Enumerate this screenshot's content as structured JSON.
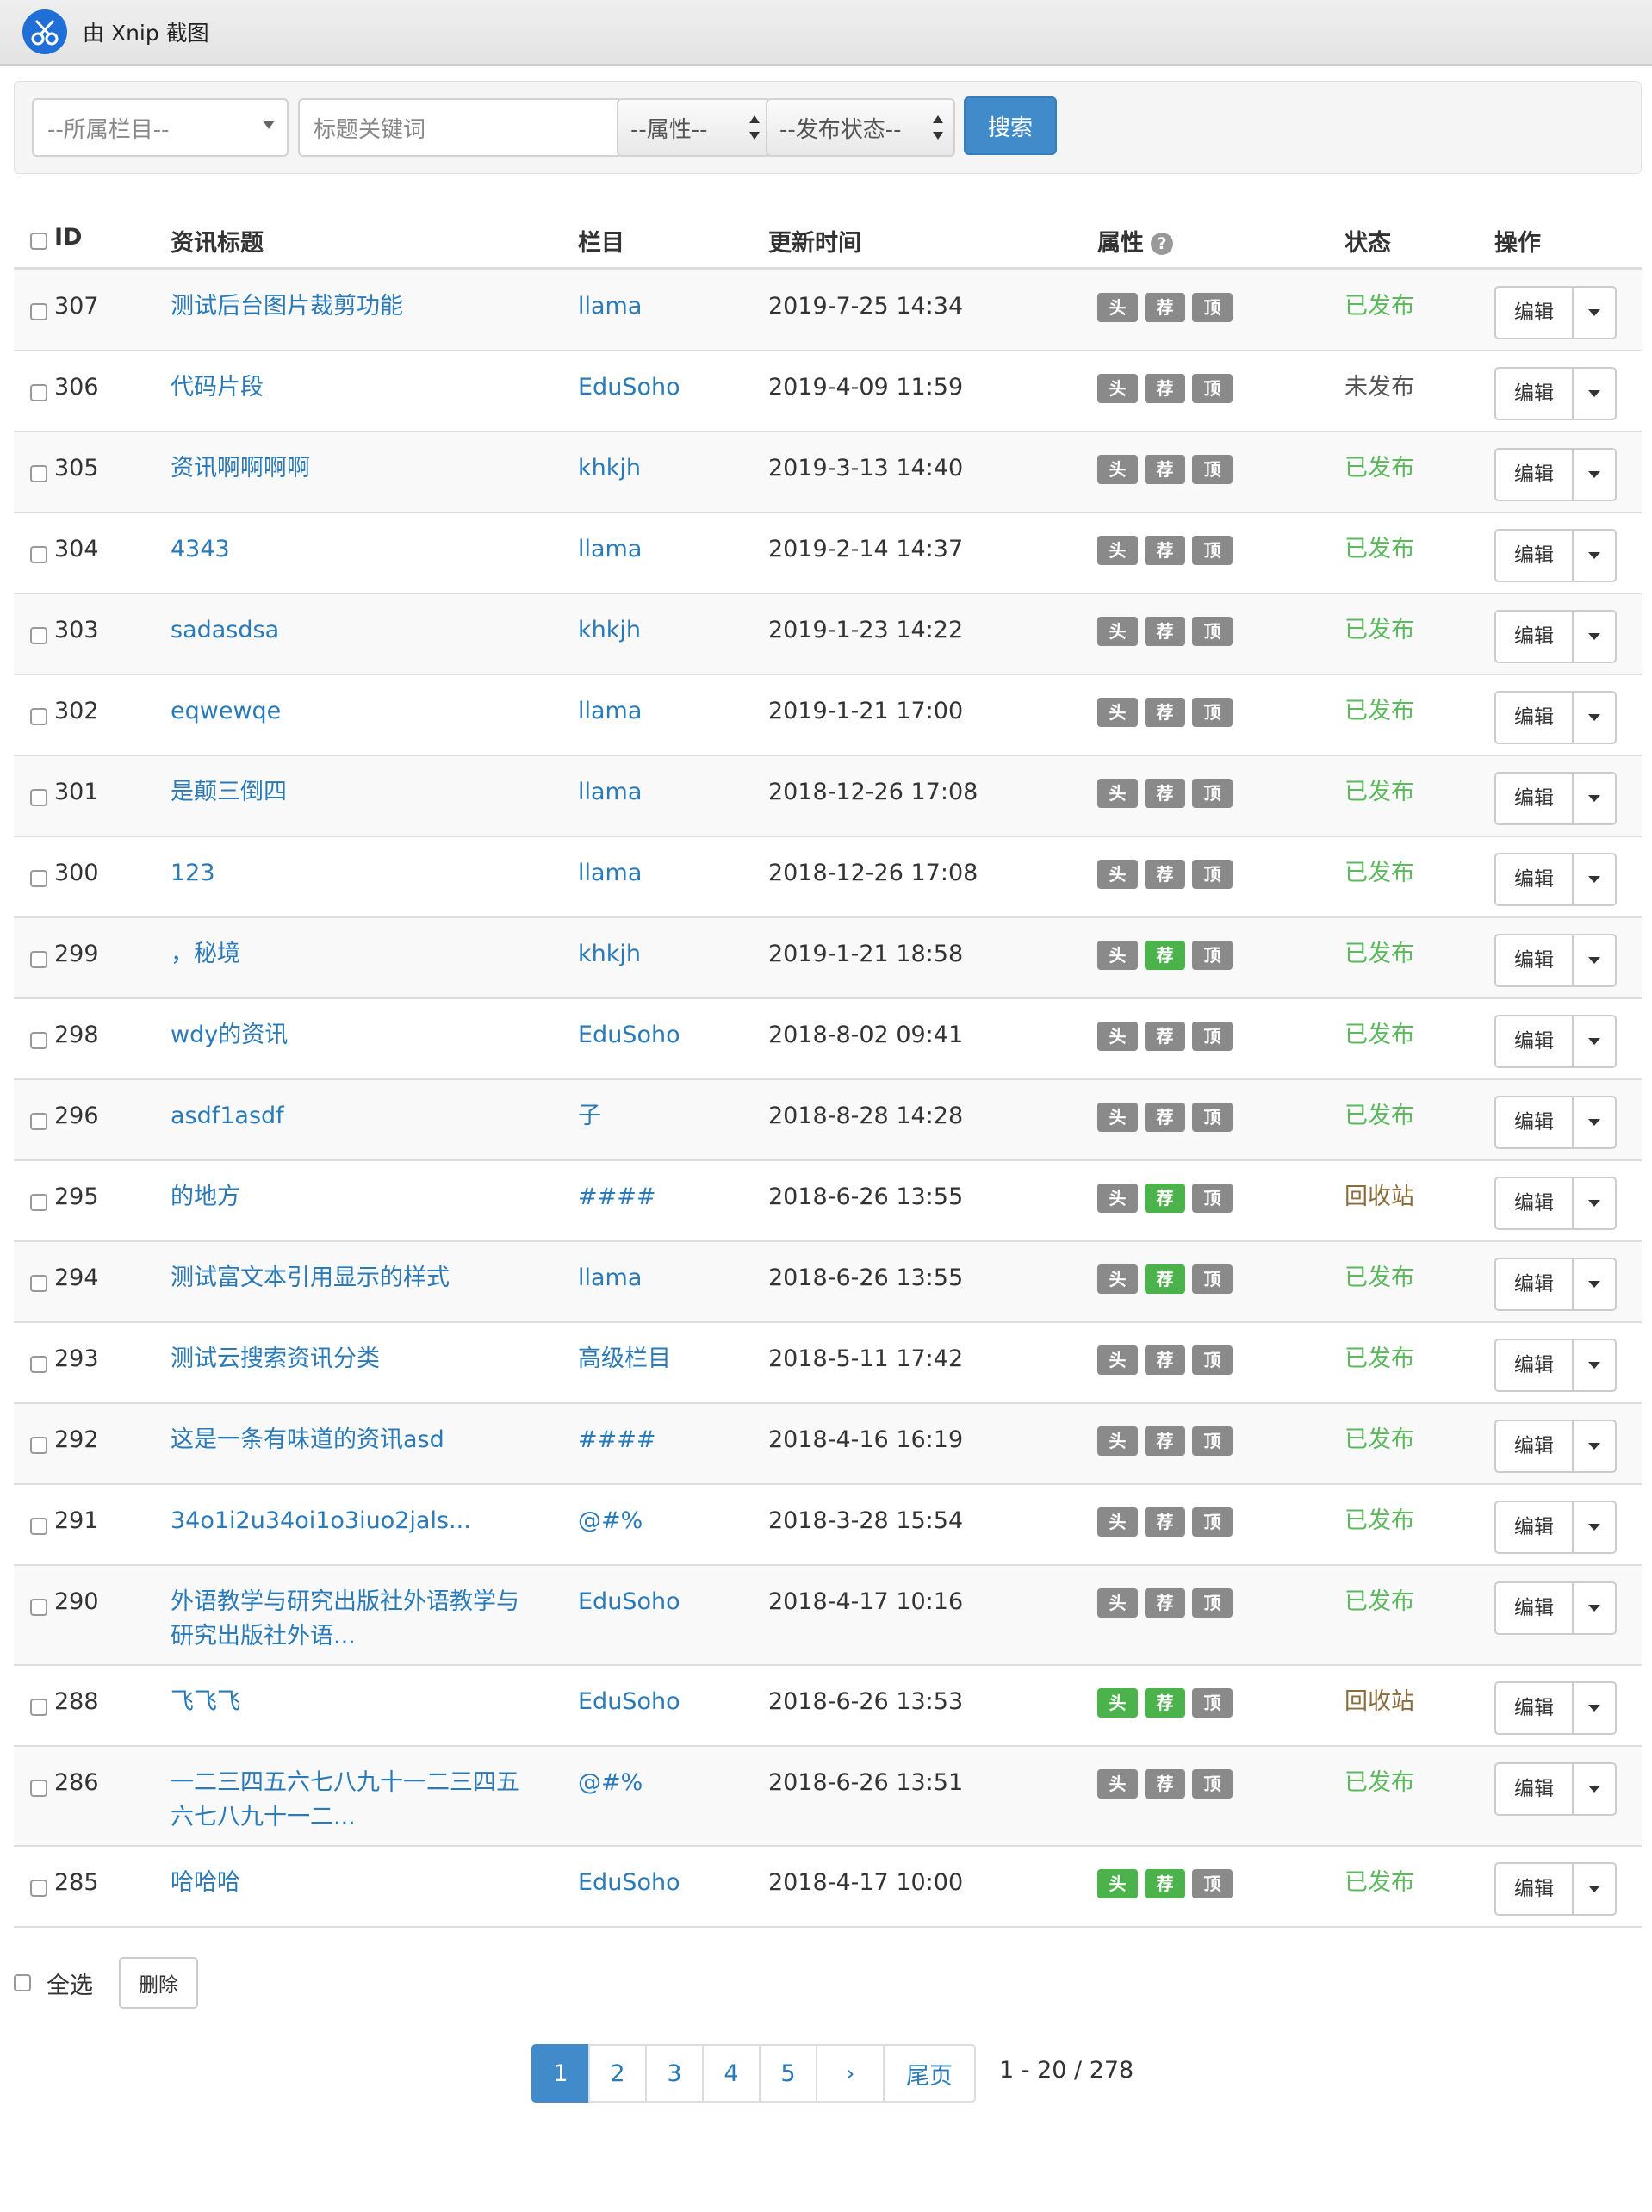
{
  "window": {
    "title": "由 Xnip 截图"
  },
  "filters": {
    "category_placeholder": "--所属栏目--",
    "keyword_placeholder": "标题关键词",
    "attribute_select": "--属性--",
    "status_select": "--发布状态--",
    "search_label": "搜索"
  },
  "table": {
    "headers": {
      "id": "ID",
      "title": "资讯标题",
      "category": "栏目",
      "updated": "更新时间",
      "attributes": "属性",
      "status": "状态",
      "actions": "操作"
    },
    "attr_labels": [
      "头",
      "荐",
      "顶"
    ],
    "edit_label": "编辑",
    "rows": [
      {
        "id": "307",
        "title": "测试后台图片裁剪功能",
        "category": "llama",
        "updated": "2019-7-25 14:34",
        "attrs": [
          false,
          false,
          false
        ],
        "status": "已发布",
        "status_kind": "published"
      },
      {
        "id": "306",
        "title": "代码片段",
        "category": "EduSoho",
        "updated": "2019-4-09 11:59",
        "attrs": [
          false,
          false,
          false
        ],
        "status": "未发布",
        "status_kind": "unpublished"
      },
      {
        "id": "305",
        "title": "资讯啊啊啊啊",
        "category": "khkjh",
        "updated": "2019-3-13 14:40",
        "attrs": [
          false,
          false,
          false
        ],
        "status": "已发布",
        "status_kind": "published"
      },
      {
        "id": "304",
        "title": "4343",
        "category": "llama",
        "updated": "2019-2-14 14:37",
        "attrs": [
          false,
          false,
          false
        ],
        "status": "已发布",
        "status_kind": "published"
      },
      {
        "id": "303",
        "title": "sadasdsa",
        "category": "khkjh",
        "updated": "2019-1-23 14:22",
        "attrs": [
          false,
          false,
          false
        ],
        "status": "已发布",
        "status_kind": "published"
      },
      {
        "id": "302",
        "title": "eqwewqe",
        "category": "llama",
        "updated": "2019-1-21 17:00",
        "attrs": [
          false,
          false,
          false
        ],
        "status": "已发布",
        "status_kind": "published"
      },
      {
        "id": "301",
        "title": "是颠三倒四",
        "category": "llama",
        "updated": "2018-12-26 17:08",
        "attrs": [
          false,
          false,
          false
        ],
        "status": "已发布",
        "status_kind": "published"
      },
      {
        "id": "300",
        "title": "123",
        "category": "llama",
        "updated": "2018-12-26 17:08",
        "attrs": [
          false,
          false,
          false
        ],
        "status": "已发布",
        "status_kind": "published"
      },
      {
        "id": "299",
        "title": "，秘境",
        "category": "khkjh",
        "updated": "2019-1-21 18:58",
        "attrs": [
          false,
          true,
          false
        ],
        "status": "已发布",
        "status_kind": "published"
      },
      {
        "id": "298",
        "title": "wdy的资讯",
        "category": "EduSoho",
        "updated": "2018-8-02 09:41",
        "attrs": [
          false,
          false,
          false
        ],
        "status": "已发布",
        "status_kind": "published"
      },
      {
        "id": "296",
        "title": "asdf1asdf",
        "category": "子",
        "updated": "2018-8-28 14:28",
        "attrs": [
          false,
          false,
          false
        ],
        "status": "已发布",
        "status_kind": "published"
      },
      {
        "id": "295",
        "title": "的地方",
        "category": "####",
        "updated": "2018-6-26 13:55",
        "attrs": [
          false,
          true,
          false
        ],
        "status": "回收站",
        "status_kind": "recycled"
      },
      {
        "id": "294",
        "title": "测试富文本引用显示的样式",
        "category": "llama",
        "updated": "2018-6-26 13:55",
        "attrs": [
          false,
          true,
          false
        ],
        "status": "已发布",
        "status_kind": "published"
      },
      {
        "id": "293",
        "title": "测试云搜索资讯分类",
        "category": "高级栏目",
        "updated": "2018-5-11 17:42",
        "attrs": [
          false,
          false,
          false
        ],
        "status": "已发布",
        "status_kind": "published"
      },
      {
        "id": "292",
        "title": "这是一条有味道的资讯asd",
        "category": "####",
        "updated": "2018-4-16 16:19",
        "attrs": [
          false,
          false,
          false
        ],
        "status": "已发布",
        "status_kind": "published"
      },
      {
        "id": "291",
        "title": "34o1i2u34oi1o3iuo2jals...",
        "category": "@#%",
        "updated": "2018-3-28 15:54",
        "attrs": [
          false,
          false,
          false
        ],
        "status": "已发布",
        "status_kind": "published"
      },
      {
        "id": "290",
        "title": "外语教学与研究出版社外语教学与研究出版社外语...",
        "category": "EduSoho",
        "updated": "2018-4-17 10:16",
        "attrs": [
          false,
          false,
          false
        ],
        "status": "已发布",
        "status_kind": "published"
      },
      {
        "id": "288",
        "title": "飞飞飞",
        "category": "EduSoho",
        "updated": "2018-6-26 13:53",
        "attrs": [
          true,
          true,
          false
        ],
        "status": "回收站",
        "status_kind": "recycled"
      },
      {
        "id": "286",
        "title": "一二三四五六七八九十一二三四五六七八九十一二...",
        "category": "@#%",
        "updated": "2018-6-26 13:51",
        "attrs": [
          false,
          false,
          false
        ],
        "status": "已发布",
        "status_kind": "published"
      },
      {
        "id": "285",
        "title": "哈哈哈",
        "category": "EduSoho",
        "updated": "2018-4-17 10:00",
        "attrs": [
          true,
          true,
          false
        ],
        "status": "已发布",
        "status_kind": "published"
      }
    ]
  },
  "footer": {
    "select_all_label": "全选",
    "delete_label": "删除"
  },
  "pagination": {
    "pages": [
      "1",
      "2",
      "3",
      "4",
      "5"
    ],
    "current": "1",
    "next_label": "›",
    "last_label": "尾页",
    "summary": "1 - 20 / 278"
  },
  "colors": {
    "published": "#5cb85c",
    "unpublished": "#555555",
    "recycled": "#8a6d3b",
    "link": "#2a7ab8",
    "primary": "#428bca",
    "badge_on": "#4cb34c",
    "badge_off": "#8a8a8a"
  }
}
